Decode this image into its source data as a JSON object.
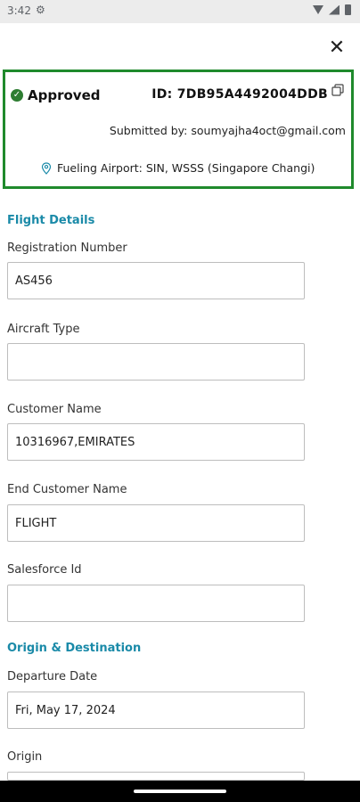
{
  "status_bar": {
    "time": "3:42"
  },
  "status_card": {
    "status": "Approved",
    "id_text": "ID: 7DB95A4492004DDB",
    "submitted_by": "Submitted by: soumyajha4oct@gmail.com",
    "fueling_airport": "Fueling Airport: SIN, WSSS (Singapore Changi)",
    "status_color": "#1f8a2c"
  },
  "sections": {
    "flight_details": "Flight Details",
    "origin_destination": "Origin & Destination"
  },
  "fields": {
    "registration_number": {
      "label": "Registration Number",
      "value": "AS456"
    },
    "aircraft_type": {
      "label": "Aircraft Type",
      "value": ""
    },
    "customer_name": {
      "label": "Customer Name",
      "value": "10316967,EMIRATES"
    },
    "end_customer_name": {
      "label": "End Customer Name",
      "value": "FLIGHT"
    },
    "salesforce_id": {
      "label": "Salesforce Id",
      "value": ""
    },
    "departure_date": {
      "label": "Departure Date",
      "value": "Fri, May 17, 2024"
    },
    "origin": {
      "label": "Origin",
      "value": ""
    }
  },
  "colors": {
    "accent": "#1a8aa8",
    "approved": "#2e7d32"
  }
}
